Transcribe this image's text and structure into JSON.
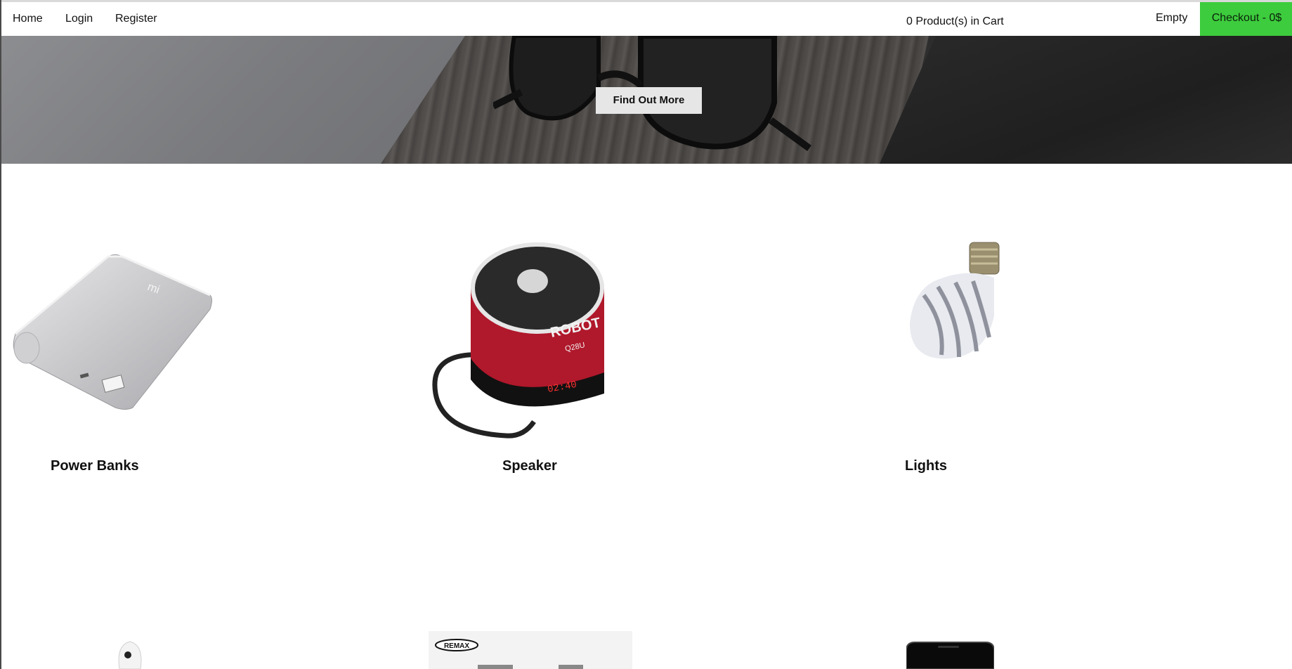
{
  "navbar": {
    "links": [
      "Home",
      "Login",
      "Register"
    ],
    "cart_count": "0 Product(s) in Cart",
    "cart_status": "Empty",
    "checkout": "Checkout - 0$"
  },
  "hero": {
    "button": "Find Out More"
  },
  "products": [
    {
      "name": "Power Banks",
      "icon": "power-bank-image"
    },
    {
      "name": "Speaker",
      "icon": "speaker-image",
      "text": "ROBOT",
      "subtext": "Q28U"
    },
    {
      "name": "Lights",
      "icon": "light-bulb-image"
    }
  ],
  "products_row2": [
    {
      "icon": "earbuds-image"
    },
    {
      "icon": "cable-image",
      "brand": "REMAX"
    },
    {
      "icon": "phone-image"
    }
  ],
  "colors": {
    "checkout_green": "#3dcc3d",
    "speaker_red": "#b0182b"
  }
}
